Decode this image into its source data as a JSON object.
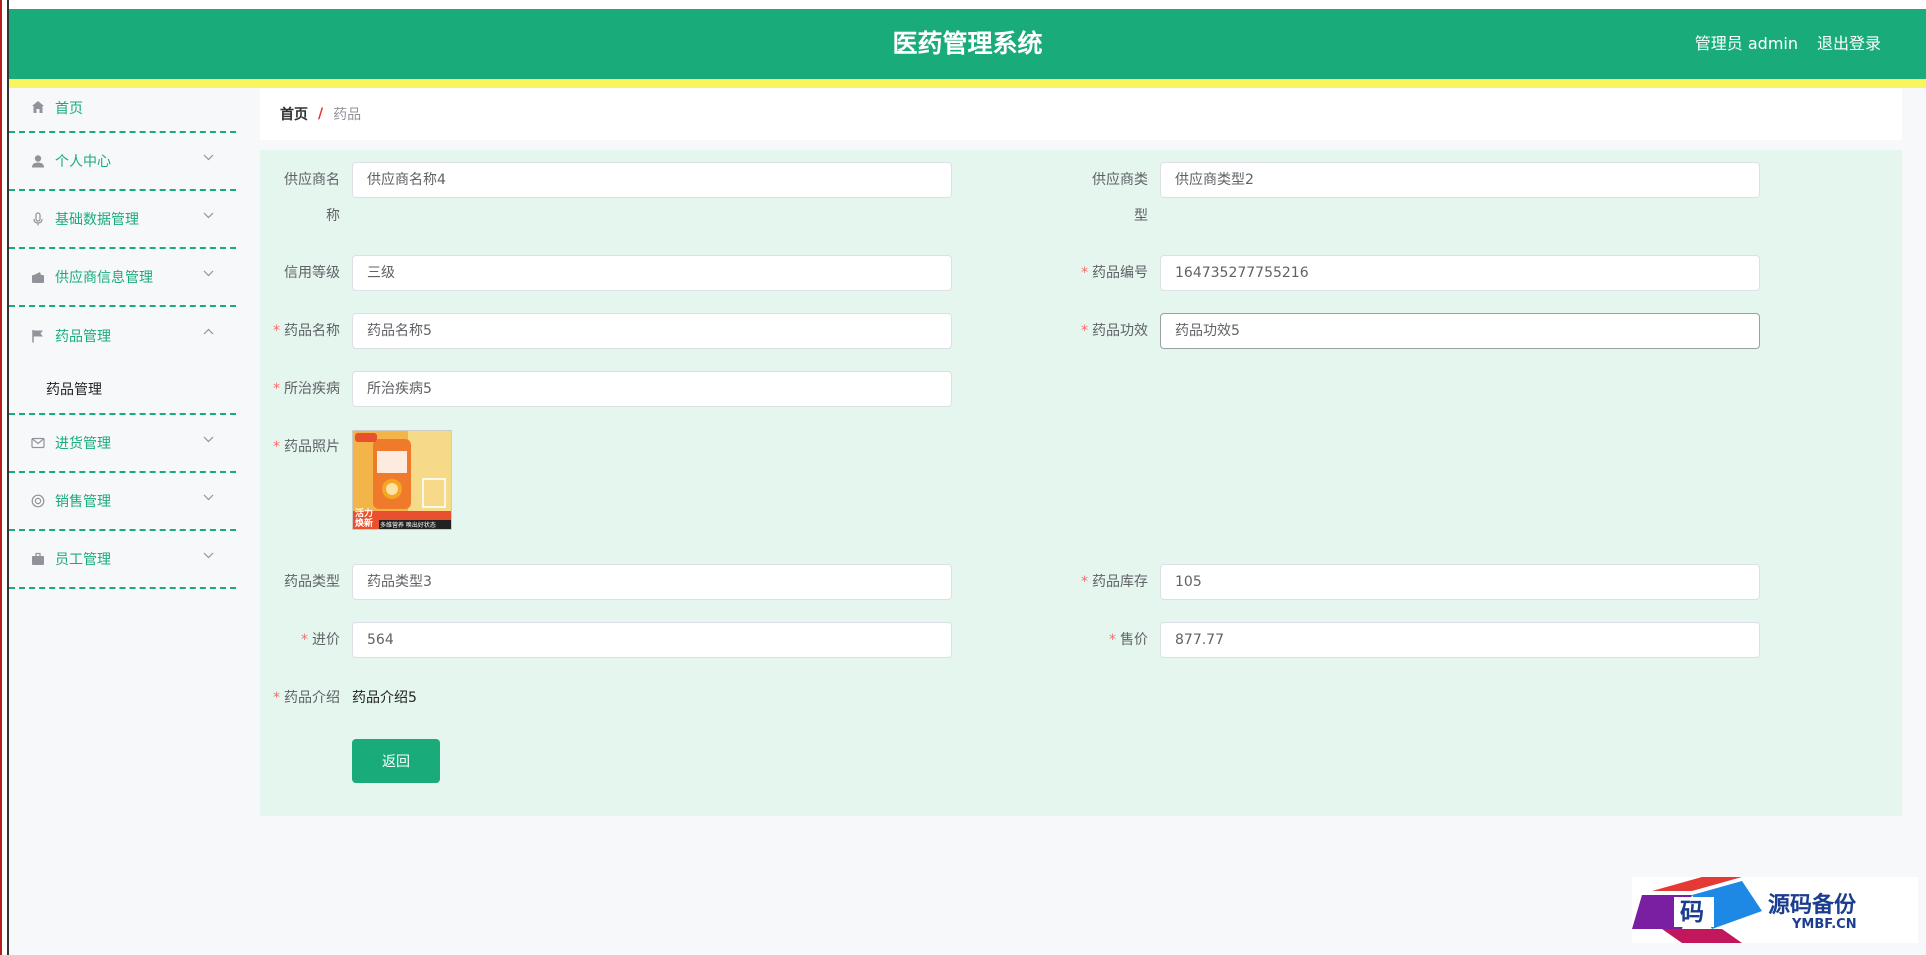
{
  "header": {
    "title": "医药管理系统",
    "user": "管理员 admin",
    "logout": "退出登录"
  },
  "sidebar": {
    "items": [
      {
        "label": "首页",
        "icon": "home-icon"
      },
      {
        "label": "个人中心",
        "icon": "user-icon"
      },
      {
        "label": "基础数据管理",
        "icon": "microphone-icon"
      },
      {
        "label": "供应商信息管理",
        "icon": "wallet-icon"
      },
      {
        "label": "药品管理",
        "icon": "flag-icon"
      },
      {
        "label": "进货管理",
        "icon": "message-icon"
      },
      {
        "label": "销售管理",
        "icon": "lifebuoy-icon"
      },
      {
        "label": "员工管理",
        "icon": "briefcase-icon"
      }
    ],
    "sub_item": "药品管理"
  },
  "breadcrumb": {
    "home": "首页",
    "separator": "/",
    "current": "药品"
  },
  "form": {
    "supplier_name": {
      "label_line1": "供应商名",
      "label_line2": "称",
      "value": "供应商名称4"
    },
    "supplier_type": {
      "label_line1": "供应商类",
      "label_line2": "型",
      "value": "供应商类型2"
    },
    "credit_level": {
      "label": "信用等级",
      "value": "三级"
    },
    "drug_code": {
      "label": "药品编号",
      "value": "164735277755216"
    },
    "drug_name": {
      "label": "药品名称",
      "value": "药品名称5"
    },
    "drug_effect": {
      "label": "药品功效",
      "value": "药品功效5"
    },
    "disease": {
      "label": "所治疾病",
      "value": "所治疾病5"
    },
    "photo": {
      "label": "药品照片",
      "caption_top": "活力焕新",
      "caption_bottom": "多维营养 唤出好状态"
    },
    "drug_type": {
      "label": "药品类型",
      "value": "药品类型3"
    },
    "stock": {
      "label": "药品库存",
      "value": "105"
    },
    "purchase_price": {
      "label": "进价",
      "value": "564"
    },
    "sale_price": {
      "label": "售价",
      "value": "877.77"
    },
    "intro": {
      "label": "药品介绍",
      "value": "药品介绍5"
    },
    "required_mark": "*",
    "back_button": "返回"
  },
  "watermark": {
    "logo_char": "码",
    "title": "源码备份",
    "subtitle": "YMBF.CN"
  },
  "colors": {
    "primary": "#1aab7b",
    "accent_strip": "#f8f55e",
    "form_bg": "#e5f6ef",
    "required": "#f56c6c"
  }
}
